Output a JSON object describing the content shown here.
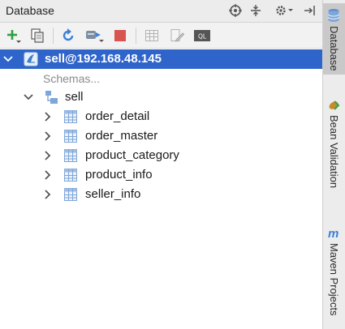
{
  "panel": {
    "title": "Database"
  },
  "tree": {
    "connection": "sell@192.168.48.145",
    "schemas_link": "Schemas...",
    "schema": "sell",
    "tables": [
      "order_detail",
      "order_master",
      "product_category",
      "product_info",
      "seller_info"
    ]
  },
  "sidebar": {
    "tabs": [
      "Database",
      "Bean Validation",
      "Maven Projects"
    ]
  },
  "colors": {
    "selection": "#2f65ca",
    "add": "#2e9e3e",
    "stop": "#d9534f",
    "refresh": "#3d7fd8"
  },
  "icons": [
    "target-icon",
    "collapse-icon",
    "gear-icon",
    "hide-icon",
    "add-icon",
    "copy-icon",
    "refresh-icon",
    "sync-icon",
    "stop-icon",
    "table-editor-icon",
    "edit-icon",
    "sql-console-icon",
    "database-icon",
    "bean-icon",
    "maven-icon"
  ]
}
